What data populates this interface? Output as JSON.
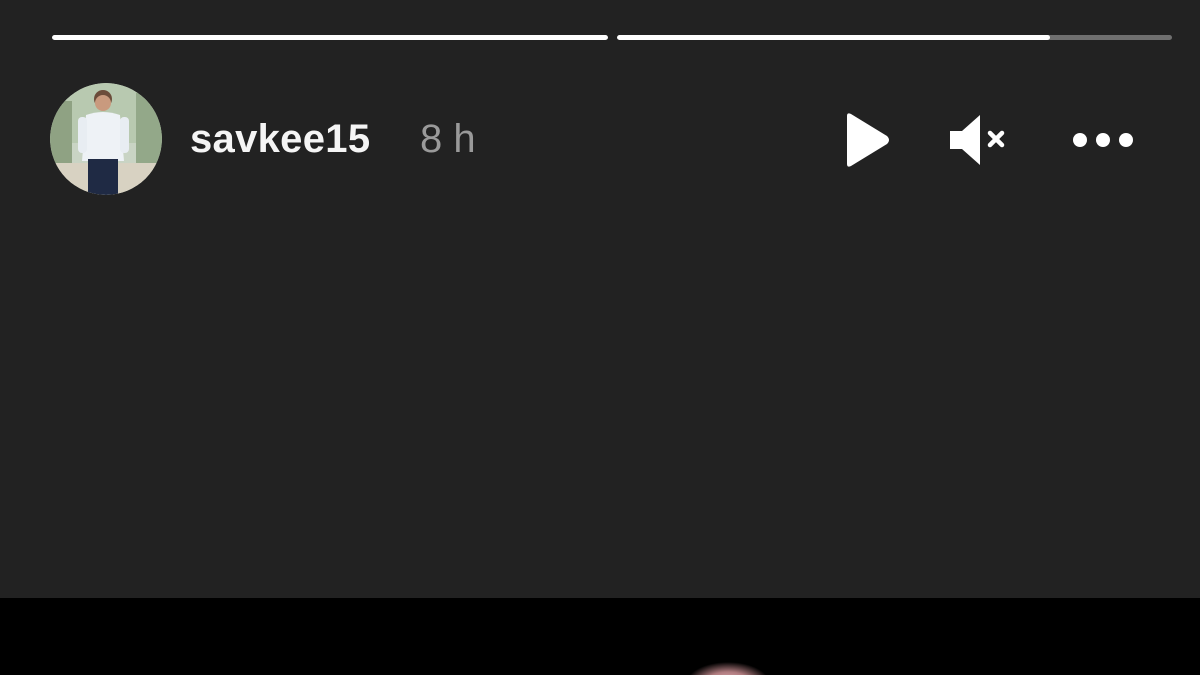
{
  "story": {
    "progress": [
      1.0,
      0.78
    ],
    "user": {
      "username": "savkee15",
      "timestamp": "8 h"
    },
    "controls": {
      "play_icon": "play-icon",
      "mute_icon": "muted-speaker-icon",
      "more_icon": "more-options-icon"
    }
  },
  "colors": {
    "background": "#222222",
    "progress_fill": "#ffffff",
    "username": "#f5f5f5",
    "timestamp": "#9a9a9a",
    "media_background": "#000000",
    "media_glow": "#e8a3a8"
  }
}
